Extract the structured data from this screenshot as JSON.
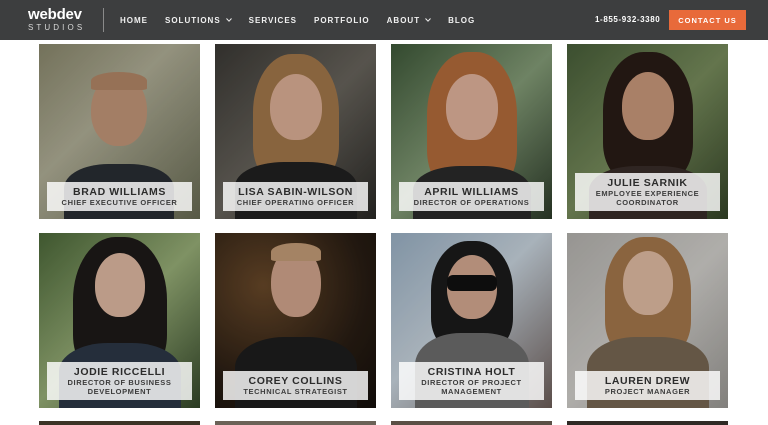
{
  "header": {
    "logo_top": "webdev",
    "logo_bottom": "STUDIOS",
    "nav": [
      {
        "label": "HOME"
      },
      {
        "label": "SOLUTIONS"
      },
      {
        "label": "SERVICES"
      },
      {
        "label": "PORTFOLIO"
      },
      {
        "label": "ABOUT"
      },
      {
        "label": "BLOG"
      }
    ],
    "phone": "1-855-932-3380",
    "contact_label": "CONTACT US"
  },
  "team": [
    {
      "name": "BRAD WILLIAMS",
      "title": "CHIEF EXECUTIVE OFFICER"
    },
    {
      "name": "LISA SABIN-WILSON",
      "title": "CHIEF OPERATING OFFICER"
    },
    {
      "name": "APRIL WILLIAMS",
      "title": "DIRECTOR OF OPERATIONS"
    },
    {
      "name": "JULIE SARNIK",
      "title": "EMPLOYEE EXPERIENCE COORDINATOR"
    },
    {
      "name": "JODIE RICCELLI",
      "title": "DIRECTOR OF BUSINESS DEVELOPMENT"
    },
    {
      "name": "COREY COLLINS",
      "title": "TECHNICAL STRATEGIST"
    },
    {
      "name": "CRISTINA HOLT",
      "title": "DIRECTOR OF PROJECT MANAGEMENT"
    },
    {
      "name": "LAUREN DREW",
      "title": "PROJECT MANAGER"
    }
  ],
  "colors": {
    "header_bg": "#3d3e3f",
    "accent": "#e86a3a"
  }
}
